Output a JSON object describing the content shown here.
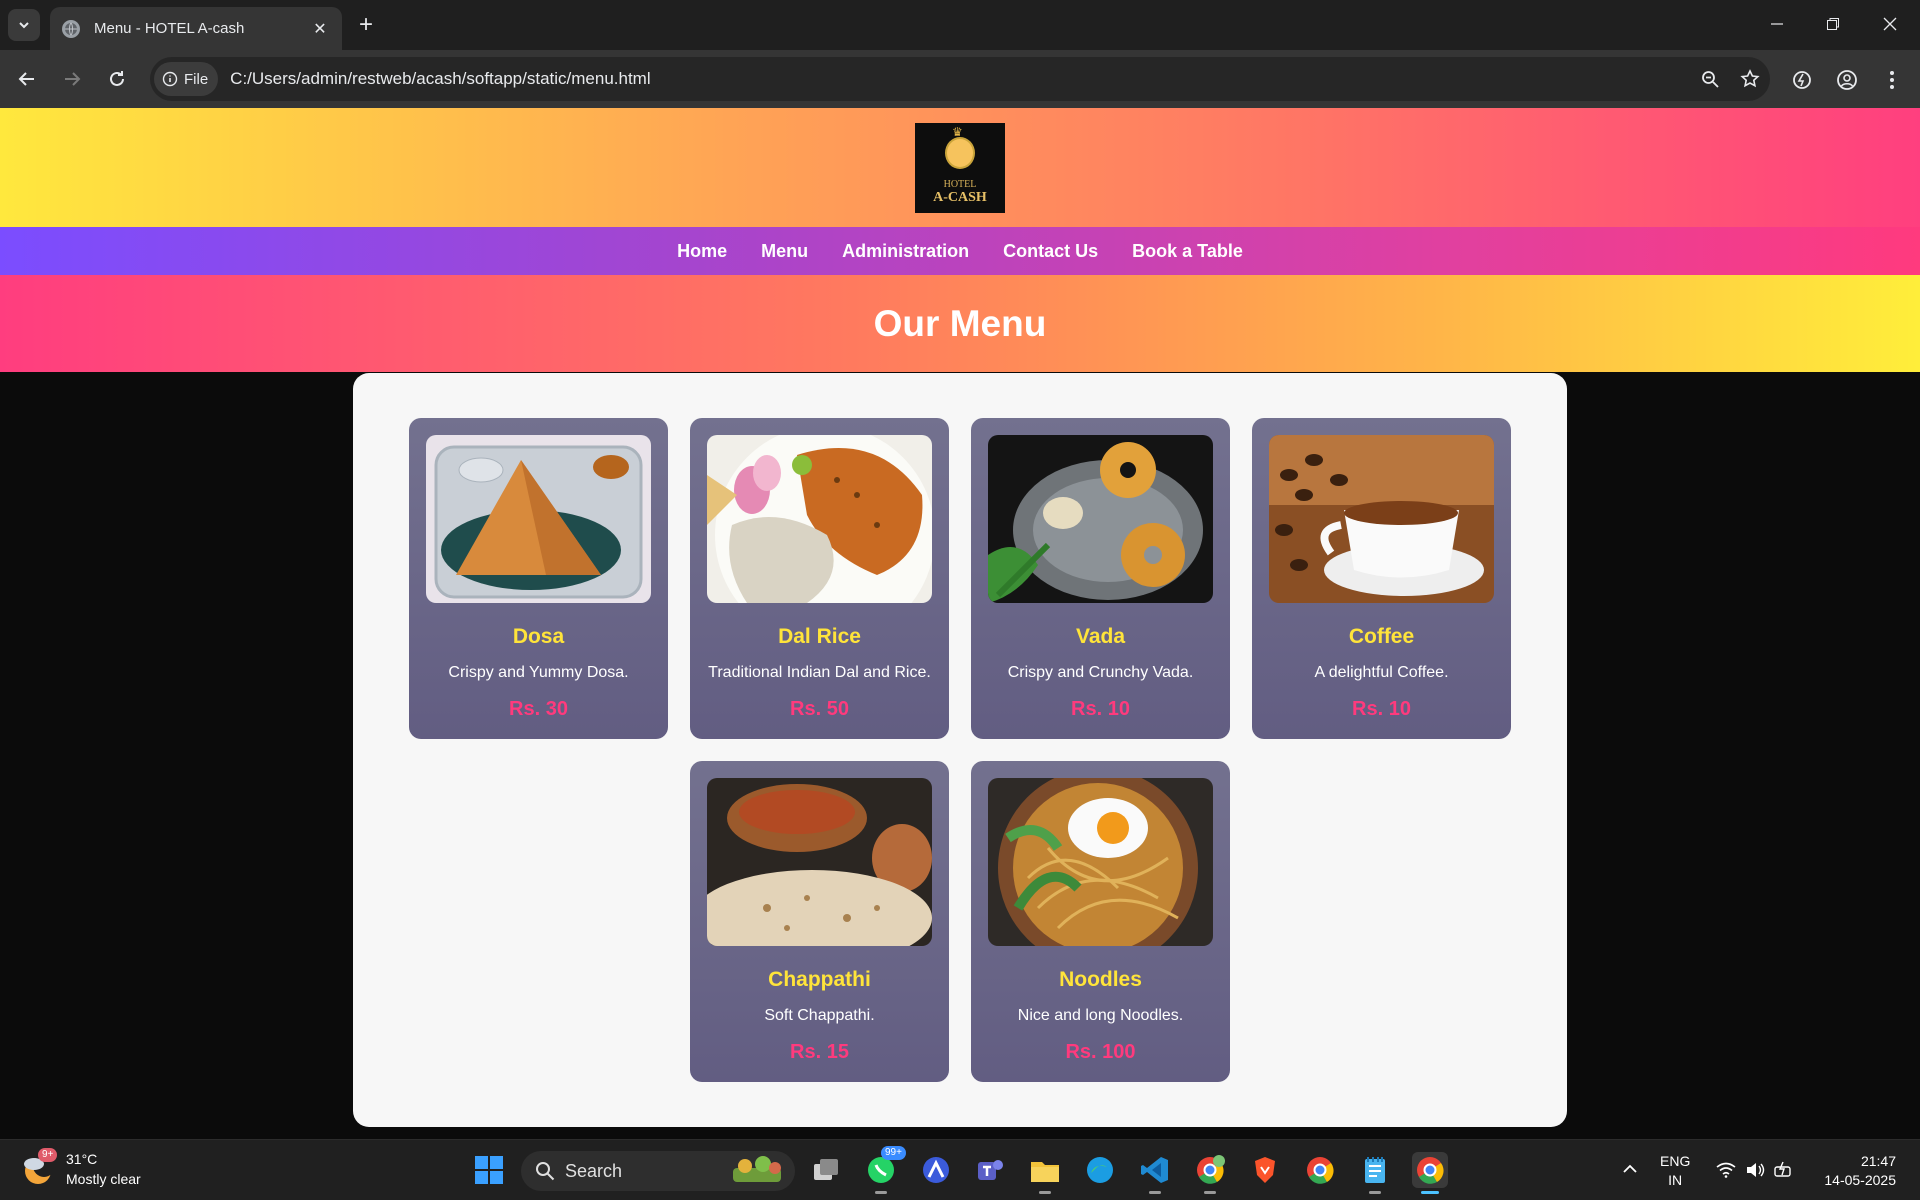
{
  "browser": {
    "tab_title": "Menu - HOTEL A-cash",
    "site_chip": "File",
    "url": "C:/Users/admin/restweb/acash/softapp/static/menu.html"
  },
  "site": {
    "logo_line1": "HOTEL",
    "logo_line2": "A-CASH",
    "nav": [
      "Home",
      "Menu",
      "Administration",
      "Contact Us",
      "Book a Table"
    ],
    "heading": "Our Menu"
  },
  "menu_items": [
    {
      "name": "Dosa",
      "desc": "Crispy and Yummy Dosa.",
      "price": "Rs. 30",
      "icon": "dosa-image"
    },
    {
      "name": "Dal Rice",
      "desc": "Traditional Indian Dal and Rice.",
      "price": "Rs. 50",
      "icon": "dal-rice-image"
    },
    {
      "name": "Vada",
      "desc": "Crispy and Crunchy Vada.",
      "price": "Rs. 10",
      "icon": "vada-image"
    },
    {
      "name": "Coffee",
      "desc": "A delightful Coffee.",
      "price": "Rs. 10",
      "icon": "coffee-image"
    },
    {
      "name": "Chappathi",
      "desc": "Soft Chappathi.",
      "price": "Rs. 15",
      "icon": "chappathi-image"
    },
    {
      "name": "Noodles",
      "desc": "Nice and long Noodles.",
      "price": "Rs. 100",
      "icon": "noodles-image"
    }
  ],
  "taskbar": {
    "weather_temp": "31°C",
    "weather_desc": "Mostly clear",
    "weather_badge": "9+",
    "search_label": "Search",
    "whatsapp_badge": "99+",
    "lang_line1": "ENG",
    "lang_line2": "IN",
    "time": "21:47",
    "date": "14-05-2025"
  },
  "colors": {
    "item_name": "#ffe43a",
    "item_price": "#ff3a7d",
    "card_bg": "#6a6688"
  }
}
